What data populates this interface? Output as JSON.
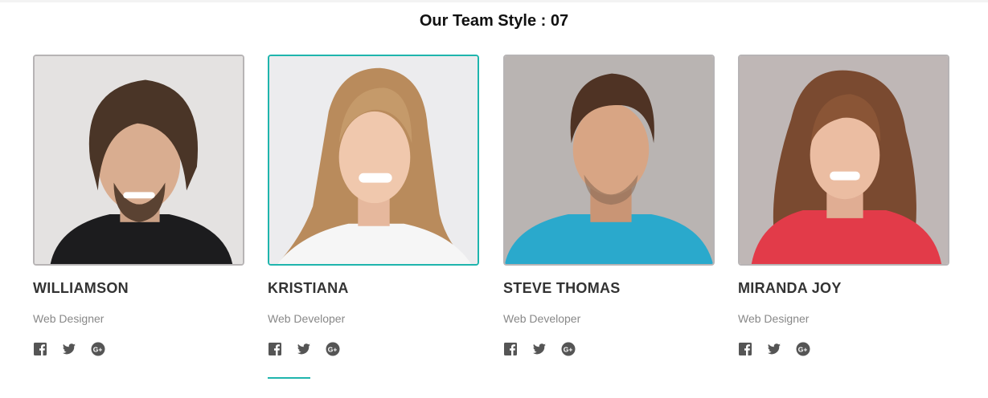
{
  "page": {
    "heading": "Our Team Style : 07"
  },
  "team": [
    {
      "name": "WILLIAMSON",
      "role": "Web Designer",
      "bg": "#e4e2e1",
      "shirt": "#1c1c1e",
      "hair": "#4a3527",
      "active": false
    },
    {
      "name": "KRISTIANA",
      "role": "Web Developer",
      "bg": "#ececee",
      "shirt": "#f6f6f6",
      "hair": "#b98b5c",
      "active": true
    },
    {
      "name": "STEVE THOMAS",
      "role": "Web Developer",
      "bg": "#b9b4b2",
      "shirt": "#2aa9cc",
      "hair": "#4f3324",
      "active": false
    },
    {
      "name": "MIRANDA JOY",
      "role": "Web Designer",
      "bg": "#bfb7b6",
      "shirt": "#e23b49",
      "hair": "#7a4a30",
      "active": false
    }
  ],
  "socials": [
    "facebook-icon",
    "twitter-icon",
    "google-plus-icon"
  ],
  "colors": {
    "accent": "#1fb5ad",
    "icon": "#555555"
  }
}
